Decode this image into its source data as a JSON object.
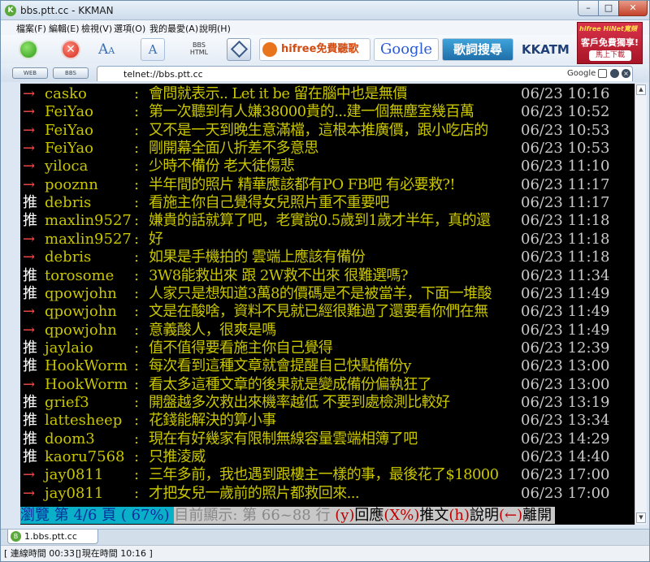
{
  "window": {
    "title": "bbs.ptt.cc - KKMAN",
    "min": "–",
    "max": "□",
    "close": "✕",
    "app_icon": "K"
  },
  "menu": [
    "檔案(F)",
    "編輯(E)",
    "檢視(V)",
    "選項(O)",
    "我的最愛(A)",
    "說明(H)"
  ],
  "toolbar": {
    "bbs_html": "BBS\nHTML",
    "hifree_label": "hifree免費聽歌",
    "google_label": "Google",
    "lyrics_label": "歌詞搜尋",
    "kkatm_label": "KKATM"
  },
  "ad": {
    "brand": "hifree HiNet寬頻",
    "line1": "客戶免費獨享!",
    "button": "馬上下載"
  },
  "address": {
    "web_btn": "WEB",
    "bbs_btn": "BBS",
    "url": "telnet://bbs.ptt.cc",
    "search_engine": "Google"
  },
  "colors": {
    "push": "#ffffff",
    "arrow": "#ff4a4a",
    "user": "#c9c600",
    "msg": "#c9c600",
    "time": "#c9c9c9"
  },
  "comments": [
    {
      "tag": "→",
      "type": "arrow",
      "user": "casko",
      "msg": "會問就表示.. Let it be 留在腦中也是無價",
      "time": "06/23 10:16"
    },
    {
      "tag": "→",
      "type": "arrow",
      "user": "FeiYao",
      "msg": "第一次聽到有人嫌38000貴的...建一個無塵室幾百萬",
      "time": "06/23 10:52"
    },
    {
      "tag": "→",
      "type": "arrow",
      "user": "FeiYao",
      "msg": "又不是一天到晚生意滿檔，這根本推廣價，跟小吃店的",
      "time": "06/23 10:53"
    },
    {
      "tag": "→",
      "type": "arrow",
      "user": "FeiYao",
      "msg": "剛開幕全面八折差不多意思",
      "time": "06/23 10:53"
    },
    {
      "tag": "→",
      "type": "arrow",
      "user": "yiloca",
      "msg": "少時不備份 老大徒傷悲",
      "time": "06/23 11:10"
    },
    {
      "tag": "→",
      "type": "arrow",
      "user": "pooznn",
      "msg": "半年間的照片 精華應該都有PO FB吧  有必要救?!",
      "time": "06/23 11:17"
    },
    {
      "tag": "推",
      "type": "push",
      "user": "debris",
      "msg": "看施主你自己覺得女兒照片重不重要吧",
      "time": "06/23 11:17"
    },
    {
      "tag": "推",
      "type": "push",
      "user": "maxlin9527",
      "msg": "嫌貴的話就算了吧，老實說0.5歲到1歲才半年，真的還",
      "time": "06/23 11:18"
    },
    {
      "tag": "→",
      "type": "arrow",
      "user": "maxlin9527",
      "msg": "好",
      "time": "06/23 11:18"
    },
    {
      "tag": "→",
      "type": "arrow",
      "user": "debris",
      "msg": "如果是手機拍的  雲端上應該有備份",
      "time": "06/23 11:18"
    },
    {
      "tag": "推",
      "type": "push",
      "user": "torosome",
      "msg": "3W8能救出來  跟 2W救不出來    很難選嗎?",
      "time": "06/23 11:34"
    },
    {
      "tag": "推",
      "type": "push",
      "user": "qpowjohn",
      "msg": "人家只是想知道3萬8的價碼是不是被當羊，下面一堆酸",
      "time": "06/23 11:49"
    },
    {
      "tag": "→",
      "type": "arrow",
      "user": "qpowjohn",
      "msg": "文是在酸啥，資料不見就已經很難過了還要看你們在無",
      "time": "06/23 11:49"
    },
    {
      "tag": "→",
      "type": "arrow",
      "user": "qpowjohn",
      "msg": "意義酸人，很爽是嗎",
      "time": "06/23 11:49"
    },
    {
      "tag": "推",
      "type": "push",
      "user": "jaylaio",
      "msg": "值不值得要看施主你自己覺得",
      "time": "06/23 12:39"
    },
    {
      "tag": "推",
      "type": "push",
      "user": "HookWorm",
      "msg": "每次看到這種文章就會提醒自己快點備份y",
      "time": "06/23 13:00"
    },
    {
      "tag": "→",
      "type": "arrow",
      "user": "HookWorm",
      "msg": "看太多這種文章的後果就是變成備份偏執狂了",
      "time": "06/23 13:00"
    },
    {
      "tag": "推",
      "type": "push",
      "user": "grief3",
      "msg": "開盤越多次救出來機率越低  不要到處檢測比較好",
      "time": "06/23 13:19"
    },
    {
      "tag": "推",
      "type": "push",
      "user": "lattesheep",
      "msg": "花錢能解決的算小事",
      "time": "06/23 13:34"
    },
    {
      "tag": "推",
      "type": "push",
      "user": "doom3",
      "msg": "現在有好幾家有限制無線容量雲端相簿了吧",
      "time": "06/23 14:29"
    },
    {
      "tag": "推",
      "type": "push",
      "user": "kaoru7568",
      "msg": "只推淩威",
      "time": "06/23 14:40"
    },
    {
      "tag": "→",
      "type": "arrow",
      "user": "jay0811",
      "msg": "三年多前，我也遇到跟樓主一樣的事，最後花了$18000",
      "time": "06/23 17:00"
    },
    {
      "tag": "→",
      "type": "arrow",
      "user": "jay0811",
      "msg": "才把女兒一歲前的照片都救回來...",
      "time": "06/23 17:00"
    }
  ],
  "status": {
    "browse": " 瀏覽 第 4/6 頁 ( 67%) ",
    "showing": " 目前顯示: 第 66~88 行 ",
    "y": "(y)",
    "reply": "回應",
    "x": "(X%)",
    "push": "推文",
    "h": "(h)",
    "help": "說明",
    "left": "(←)",
    "leave": "離開"
  },
  "tab": {
    "label": "1.bbs.ptt.cc",
    "close": "×"
  },
  "footer": {
    "connect": "[ 連線時間 00:33 ]",
    "now": "[ 現在時間 10:16 ]"
  }
}
